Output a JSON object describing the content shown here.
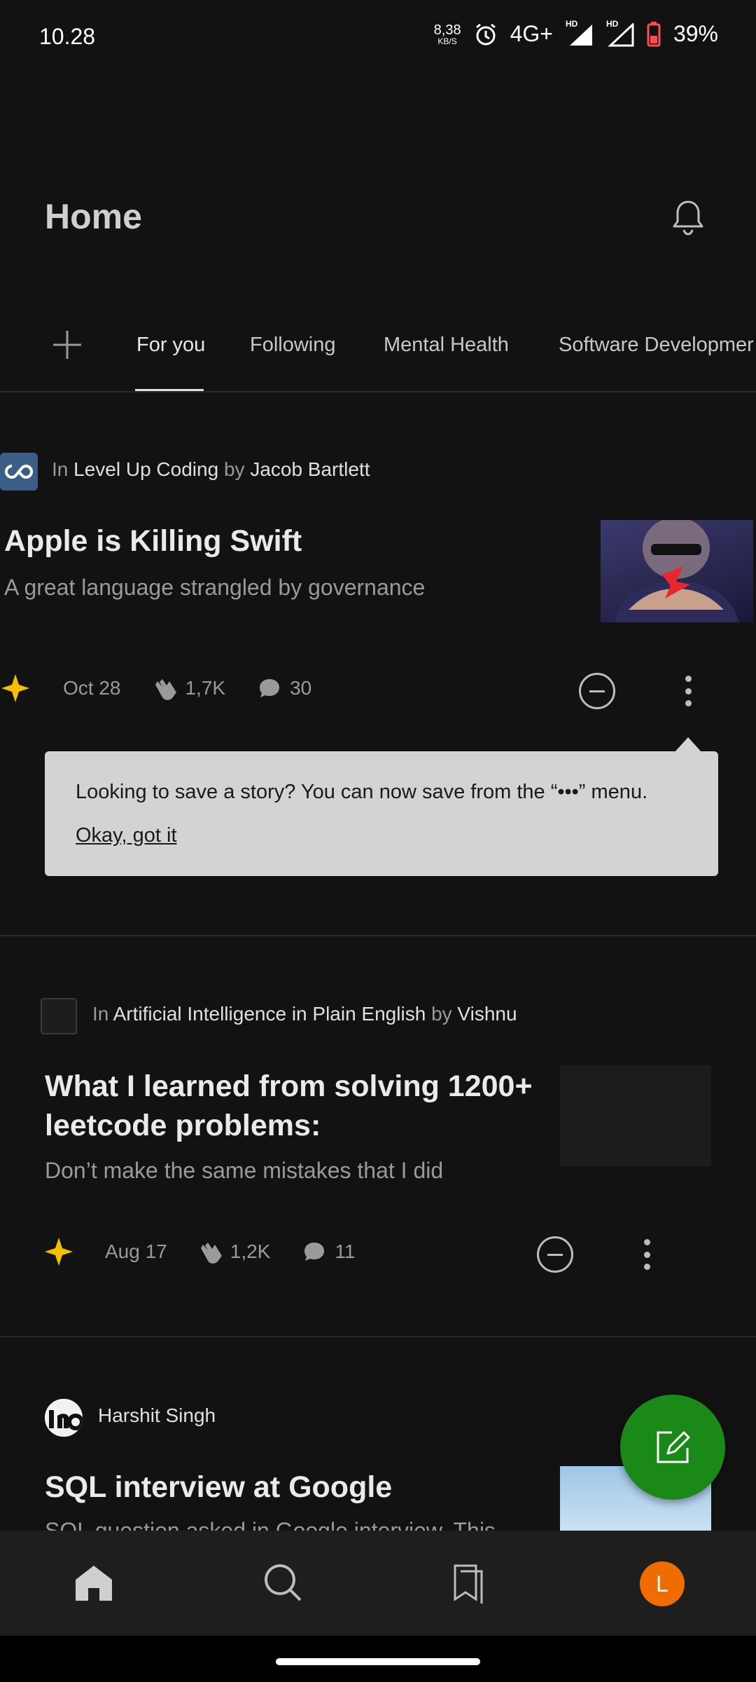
{
  "status_bar": {
    "time": "10.28",
    "speed_value": "8,38",
    "speed_unit": "KB/S",
    "network": "4G+",
    "hd1": "HD",
    "hd2": "HD",
    "battery": "39%"
  },
  "header": {
    "title": "Home"
  },
  "tabs": [
    {
      "label": "For you",
      "active": true
    },
    {
      "label": "Following"
    },
    {
      "label": "Mental Health"
    },
    {
      "label": "Software Developmer"
    }
  ],
  "articles": [
    {
      "in_label": "In",
      "publication": "Level Up Coding",
      "by_label": "by",
      "author": "Jacob Bartlett",
      "title": "Apple is Killing Swift",
      "subtitle": "A great language strangled by governance",
      "date": "Oct 28",
      "claps": "1,7K",
      "comments": "30"
    },
    {
      "in_label": "In",
      "publication": "Artificial Intelligence in Plain English",
      "by_label": "by",
      "author": "Vishnu",
      "title_line1": "What I learned from solving 1200+",
      "title_line2": "leetcode problems:",
      "subtitle": "Don’t make the same mistakes that I did",
      "date": "Aug 17",
      "claps": "1,2K",
      "comments": "11"
    },
    {
      "author": "Harshit Singh",
      "title": "SQL interview at Google",
      "subtitle": "SQL question asked in Google interview. This"
    }
  ],
  "tooltip": {
    "text": "Looking to save a story? You can now save from the “•••” menu.",
    "action": "Okay, got it"
  },
  "bottom_nav": {
    "avatar_letter": "L"
  },
  "colors": {
    "background": "#121212",
    "accent_star": "#f5c000",
    "fab": "#1a8917",
    "avatar": "#ef6c00"
  }
}
